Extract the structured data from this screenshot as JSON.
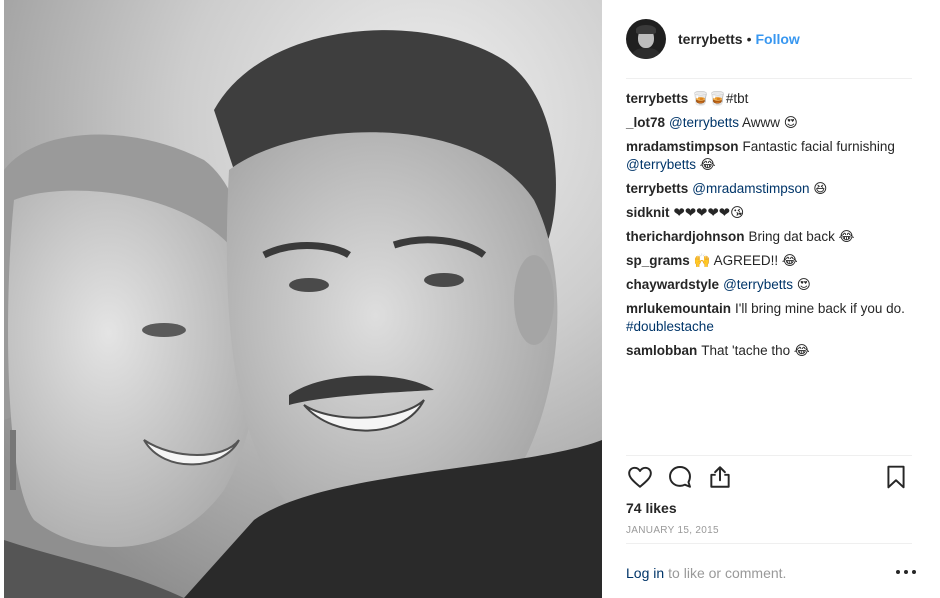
{
  "post": {
    "image_alt": "black and white selfie of a couple"
  },
  "header": {
    "username": "terrybetts",
    "separator": "•",
    "follow_label": "Follow"
  },
  "comments": [
    {
      "author": "terrybetts",
      "text": "🥃🥃#tbt",
      "mention": ""
    },
    {
      "author": "_lot78",
      "mention": "@terrybetts",
      "text": " Awww 😍"
    },
    {
      "author": "mradamstimpson",
      "text": "Fantastic facial furnishing ",
      "mention": "@terrybetts",
      "text_after": " 😂"
    },
    {
      "author": "terrybetts",
      "mention": "@mradamstimpson",
      "text": " 😆"
    },
    {
      "author": "sidknit",
      "text": "❤❤❤❤❤😘",
      "mention": ""
    },
    {
      "author": "therichardjohnson",
      "text": "Bring dat back 😂",
      "mention": ""
    },
    {
      "author": "sp_grams",
      "text": "🙌 AGREED!! 😂",
      "mention": ""
    },
    {
      "author": "chaywardstyle",
      "mention": "@terrybetts",
      "text": " 😍"
    },
    {
      "author": "mrlukemountain",
      "text": "I'll bring mine back if you do. ",
      "mention": "#doublestache"
    },
    {
      "author": "samlobban",
      "text": "That 'tache tho 😂",
      "mention": ""
    }
  ],
  "actions": {
    "like_icon": "heart-icon",
    "comment_icon": "comment-bubble-icon",
    "share_icon": "share-icon",
    "save_icon": "bookmark-icon"
  },
  "likes": "74 likes",
  "date": "JANUARY 15, 2015",
  "login": {
    "link_label": "Log in",
    "suffix": "to like or comment.",
    "more_icon": "more-options-icon"
  }
}
